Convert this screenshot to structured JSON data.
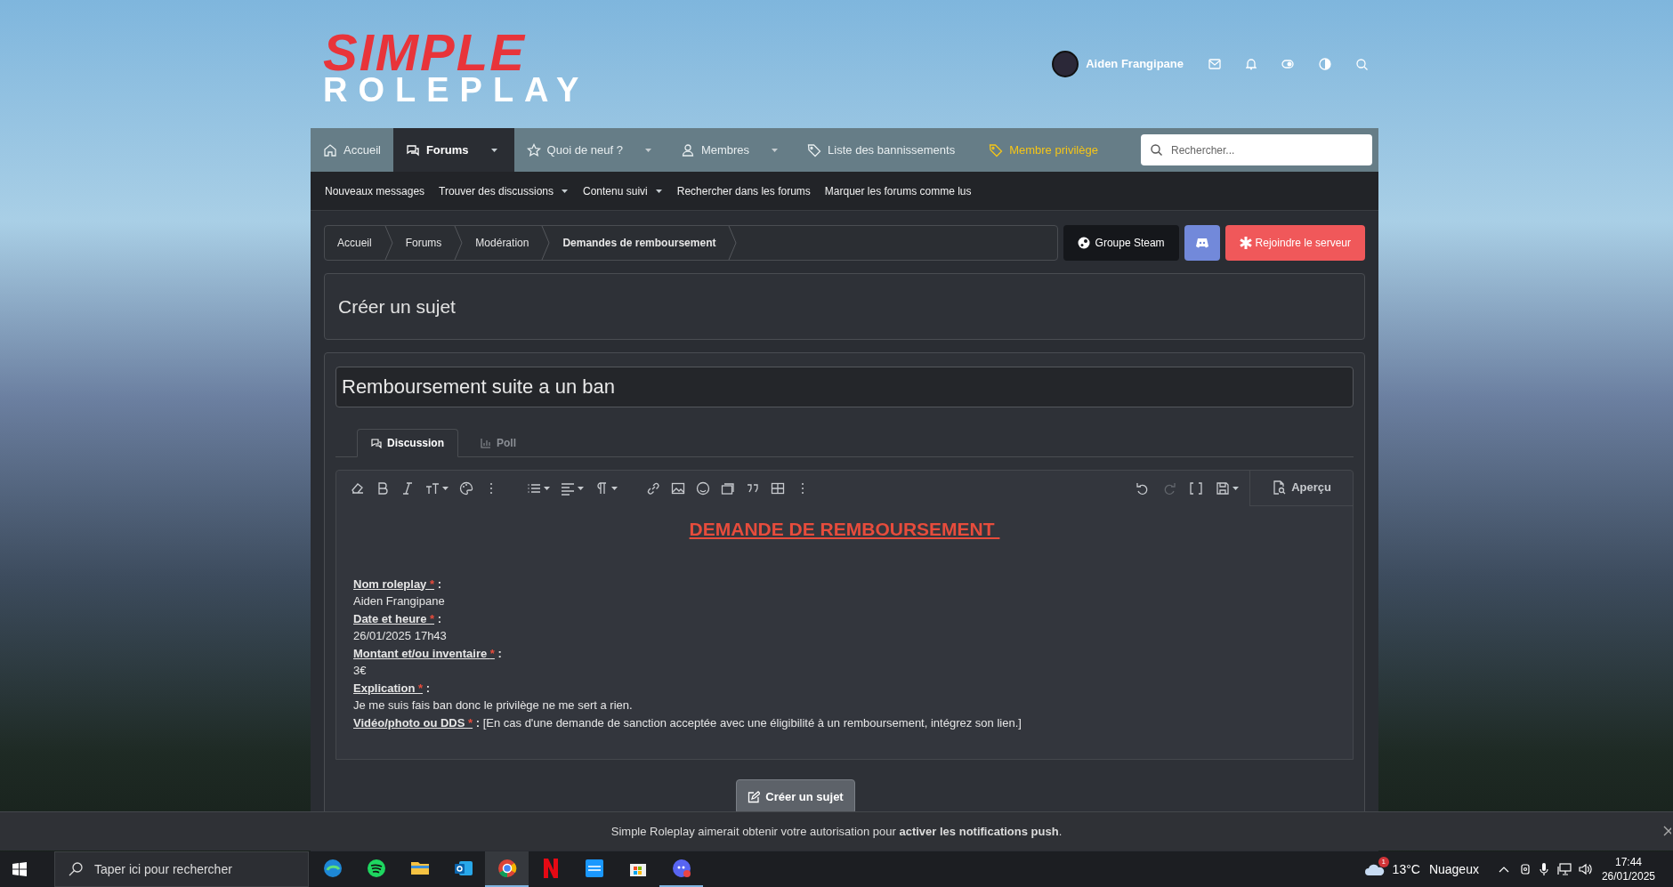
{
  "logo": {
    "line_1": "SIMPLE",
    "line_2": "ROLEPLAY"
  },
  "user": {
    "name": "Aiden Frangipane"
  },
  "nav": [
    {
      "label": "Accueil",
      "selected": false,
      "dropdown": false,
      "kind": "normal"
    },
    {
      "label": "Forums",
      "selected": true,
      "dropdown": true,
      "kind": "normal"
    },
    {
      "label": "Quoi de neuf ?",
      "selected": false,
      "dropdown": true,
      "kind": "normal"
    },
    {
      "label": "Membres",
      "selected": false,
      "dropdown": true,
      "kind": "normal"
    },
    {
      "label": "Liste des bannissements",
      "selected": false,
      "dropdown": false,
      "kind": "normal"
    },
    {
      "label": "Membre privilège",
      "selected": false,
      "dropdown": false,
      "kind": "highlight"
    }
  ],
  "search": {
    "placeholder": "Rechercher..."
  },
  "subnav": [
    {
      "label": "Nouveaux messages",
      "dropdown": false
    },
    {
      "label": "Trouver des discussions",
      "dropdown": true
    },
    {
      "label": "Contenu suivi",
      "dropdown": true
    },
    {
      "label": "Rechercher dans les forums",
      "dropdown": false
    },
    {
      "label": "Marquer les forums comme lus",
      "dropdown": false
    }
  ],
  "breadcrumb": [
    {
      "label": "Accueil",
      "current": false
    },
    {
      "label": "Forums",
      "current": false
    },
    {
      "label": "Modération",
      "current": false
    },
    {
      "label": "Demandes de remboursement",
      "current": true
    }
  ],
  "actions": [
    {
      "kind": "steam",
      "label": "Groupe Steam"
    },
    {
      "kind": "discord"
    },
    {
      "kind": "join",
      "label": "Rejoindre le serveur"
    }
  ],
  "page_title": "Créer un sujet",
  "thread_title": {
    "value": "Remboursement suite a un ban"
  },
  "tabs": [
    {
      "label": "Discussion",
      "selected": true
    },
    {
      "label": "Poll",
      "selected": false
    }
  ],
  "preview_button": "Aperçu",
  "body": {
    "heading": "DEMANDE DE REMBOURSEMENT ",
    "fields": [
      {
        "label": "Nom roleplay ",
        "marker": "*",
        "separator": " :",
        "value": "Aiden Frangipane",
        "inline": false
      },
      {
        "label": "Date et heure ",
        "marker": "*",
        "separator": " :",
        "value": "26/01/2025 17h43",
        "inline": false
      },
      {
        "label": "Montant et/ou inventaire ",
        "marker": "*",
        "separator": " :",
        "value": "3€",
        "inline": false
      },
      {
        "label": "Explication ",
        "marker": "*",
        "separator": " :",
        "value": "Je me suis fais ban donc le privilège ne me sert a rien.",
        "inline": false
      },
      {
        "label": "Vidéo/photo ou DDS ",
        "marker": "*",
        "separator": " :",
        "value": "[En cas d'une demande de sanction acceptée avec une éligibilité à un remboursement, intégrez son lien.]",
        "inline": true
      }
    ]
  },
  "submit_button": "Créer un sujet",
  "notification": "Simple Roleplay aimerait obtenir votre autorisation pour **activer les notifications push**.",
  "taskbar": {
    "search_placeholder": "Taper ici pour rechercher",
    "apps": [
      {
        "kind": "edge",
        "active": false
      },
      {
        "kind": "spotify",
        "active": false
      },
      {
        "kind": "files",
        "active": false
      },
      {
        "kind": "outlook",
        "active": false
      },
      {
        "kind": "chrome",
        "active": true
      },
      {
        "kind": "netflix",
        "active": false
      },
      {
        "kind": "prime",
        "active": false
      },
      {
        "kind": "store",
        "active": false
      },
      {
        "kind": "discord",
        "active": true
      }
    ],
    "weather_badge": "1",
    "temperature": "13°C",
    "weather": "Nuageux",
    "time": "17:44",
    "date": "26/01/2025"
  }
}
